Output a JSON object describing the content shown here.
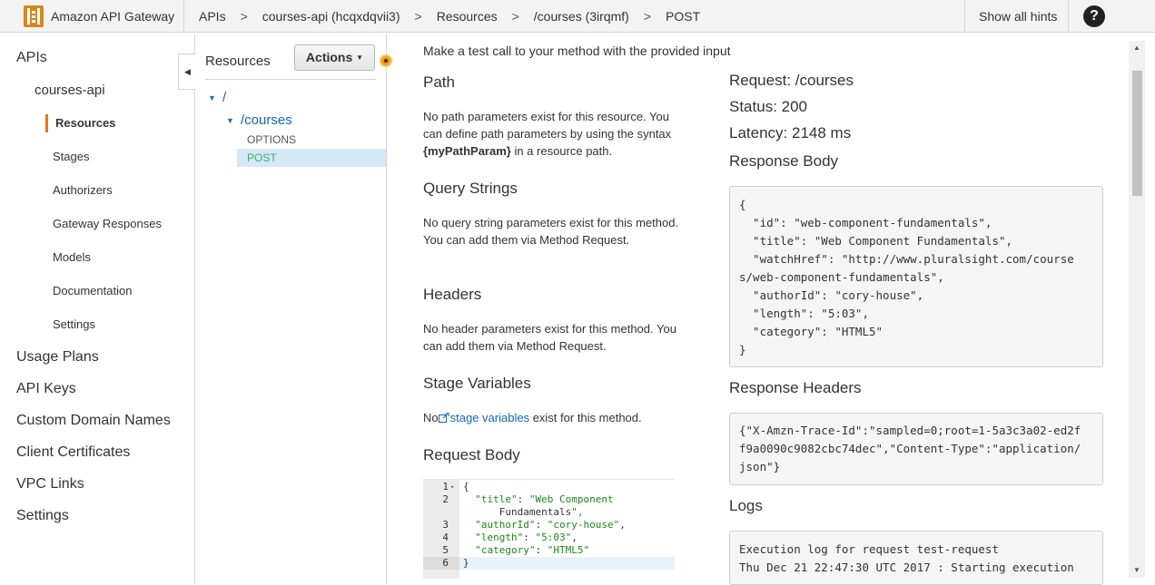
{
  "topbar": {
    "brand": "Amazon API Gateway",
    "breadcrumbs": [
      "APIs",
      "courses-api (hcqxdqvii3)",
      "Resources",
      "/courses (3irqmf)",
      "POST"
    ],
    "separator": ">",
    "hints_label": "Show all hints",
    "help_glyph": "?"
  },
  "leftnav": {
    "apis_label": "APIs",
    "api_name": "courses-api",
    "items": [
      "Resources",
      "Stages",
      "Authorizers",
      "Gateway Responses",
      "Models",
      "Documentation",
      "Settings"
    ],
    "active_item": "Resources",
    "main_items": [
      "Usage Plans",
      "API Keys",
      "Custom Domain Names",
      "Client Certificates",
      "VPC Links",
      "Settings"
    ]
  },
  "resources": {
    "title": "Resources",
    "actions_label": "Actions",
    "tree": {
      "root": "/",
      "child": "/courses",
      "methods": [
        "OPTIONS",
        "POST"
      ],
      "selected_method": "POST"
    }
  },
  "test": {
    "intro": "Make a test call to your method with the provided input",
    "path_heading": "Path",
    "path_text_1": "No path parameters exist for this resource. You can define path parameters by using the syntax ",
    "path_param": "{myPathParam}",
    "path_text_2": " in a resource path.",
    "query_heading": "Query Strings",
    "query_text": "No query string parameters exist for this method. You can add them via Method Request.",
    "headers_heading": "Headers",
    "headers_text": "No header parameters exist for this method. You can add them via Method Request.",
    "stage_heading": "Stage Variables",
    "stage_text_1": "No",
    "stage_link": "stage variables",
    "stage_text_2": " exist for this method.",
    "body_heading": "Request Body"
  },
  "editor": {
    "lines": [
      {
        "num": "1",
        "fold": "▾",
        "code": "{"
      },
      {
        "num": "2",
        "fold": "",
        "code": "  \"title\": \"Web Component"
      },
      {
        "num": "",
        "fold": "",
        "code": "      Fundamentals\","
      },
      {
        "num": "3",
        "fold": "",
        "code": "  \"authorId\": \"cory-house\","
      },
      {
        "num": "4",
        "fold": "",
        "code": "  \"length\": \"5:03\","
      },
      {
        "num": "5",
        "fold": "",
        "code": "  \"category\": \"HTML5\""
      },
      {
        "num": "6",
        "fold": "",
        "code": "}"
      }
    ]
  },
  "response": {
    "request": "Request: /courses",
    "status": "Status: 200",
    "latency": "Latency: 2148 ms",
    "body_heading": "Response Body",
    "body": "{\n  \"id\": \"web-component-fundamentals\",\n  \"title\": \"Web Component Fundamentals\",\n  \"watchHref\": \"http://www.pluralsight.com/course\ns/web-component-fundamentals\",\n  \"authorId\": \"cory-house\",\n  \"length\": \"5:03\",\n  \"category\": \"HTML5\"\n}",
    "headers_heading": "Response Headers",
    "headers": "{\"X-Amzn-Trace-Id\":\"sampled=0;root=1-5a3c3a02-ed2f\nf9a0090c9082cbc74dec\",\"Content-Type\":\"application/\njson\"}",
    "logs_heading": "Logs",
    "logs": "Execution log for request test-request\nThu Dec 21 22:47:30 UTC 2017 : Starting execution"
  },
  "colors": {
    "accent_orange": "#e07b1e",
    "link_blue": "#1166bb",
    "selected_bg": "#d4e8f7",
    "post_green": "#44aa66"
  }
}
